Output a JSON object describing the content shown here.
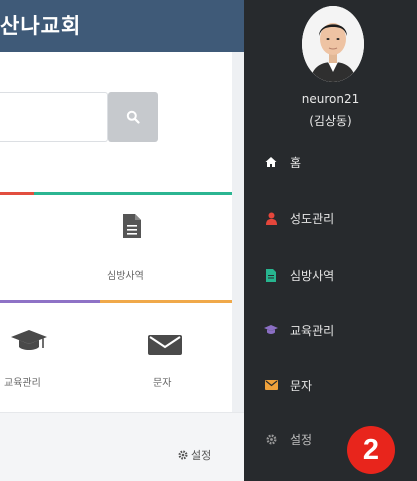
{
  "background_app": {
    "title": "산나교회",
    "cards": {
      "visit_label": "심방사역",
      "edu_label": "교육관리",
      "msg_label": "문자"
    },
    "settings_label": "설정",
    "icons": [
      "search-icon",
      "document-icon",
      "graduation-cap-icon",
      "envelope-icon",
      "gear-icon"
    ]
  },
  "drawer": {
    "username": "neuron21",
    "realname": "(김상동)",
    "menu": [
      {
        "label": "홈",
        "icon": "home-icon",
        "color": "#ffffff"
      },
      {
        "label": "성도관리",
        "icon": "user-icon",
        "color": "#e5463b"
      },
      {
        "label": "심방사역",
        "icon": "document-icon",
        "color": "#27b58f"
      },
      {
        "label": "교육관리",
        "icon": "graduation-cap-icon",
        "color": "#8b6fc4"
      },
      {
        "label": "문자",
        "icon": "envelope-icon",
        "color": "#f0a23b"
      },
      {
        "label": "설정",
        "icon": "gear-icon",
        "color": "#9a9a9a"
      }
    ]
  },
  "annotation": {
    "badge": "2",
    "color": "#e8251c"
  },
  "colors": {
    "header": "#3f5a78",
    "drawer_bg": "#272a2d"
  }
}
